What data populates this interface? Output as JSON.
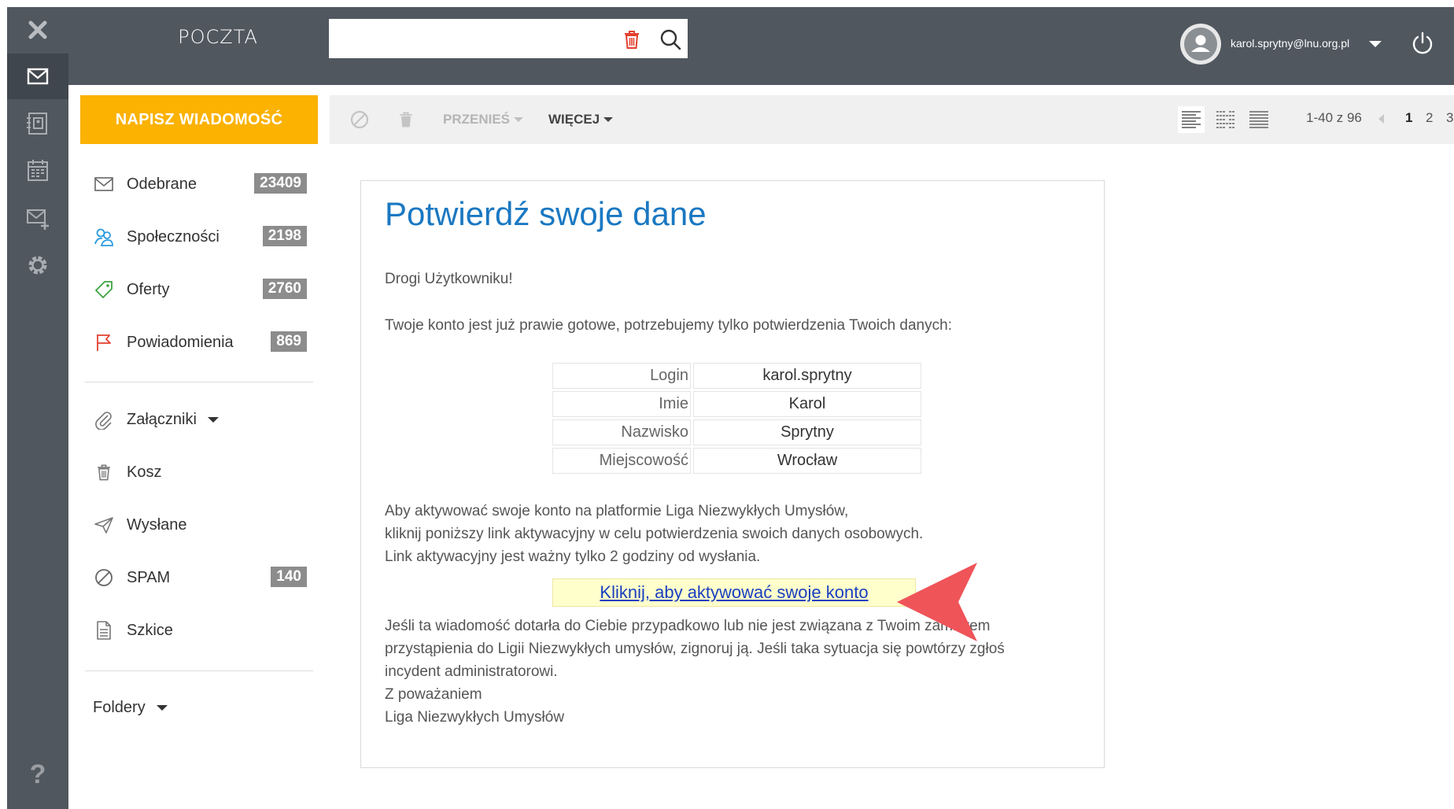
{
  "app": {
    "title": "POCZTA"
  },
  "header": {
    "search": {
      "value": "",
      "placeholder": ""
    },
    "user_email": "karol.sprytny@lnu.org.pl"
  },
  "rail": {
    "items": [
      {
        "name": "close",
        "icon": "close-icon"
      },
      {
        "name": "mail",
        "icon": "envelope-icon",
        "active": true
      },
      {
        "name": "contacts",
        "icon": "address-book-icon"
      },
      {
        "name": "calendar",
        "icon": "calendar-icon"
      },
      {
        "name": "new-mail",
        "icon": "envelope-plus-icon"
      },
      {
        "name": "settings",
        "icon": "gear-icon"
      }
    ],
    "help_label": "?"
  },
  "compose": {
    "label": "NAPISZ WIADOMOŚĆ"
  },
  "toolbar": {
    "move_label": "PRZENIEŚ",
    "more_label": "WIĘCEJ",
    "paging": "1-40 z 96",
    "pages": [
      "1",
      "2",
      "3"
    ],
    "current_page": "1"
  },
  "sidebar": {
    "folders": [
      {
        "label": "Odebrane",
        "count": "23409",
        "icon": "envelope-icon"
      },
      {
        "label": "Społeczności",
        "count": "2198",
        "icon": "people-icon"
      },
      {
        "label": "Oferty",
        "count": "2760",
        "icon": "tag-icon"
      },
      {
        "label": "Powiadomienia",
        "count": "869",
        "icon": "flag-icon"
      },
      {
        "label": "Załączniki",
        "count": "",
        "icon": "paperclip-icon"
      },
      {
        "label": "Kosz",
        "count": "",
        "icon": "trash-icon"
      },
      {
        "label": "Wysłane",
        "count": "",
        "icon": "send-icon"
      },
      {
        "label": "SPAM",
        "count": "140",
        "icon": "ban-icon"
      },
      {
        "label": "Szkice",
        "count": "",
        "icon": "document-icon"
      }
    ],
    "custom_folders_label": "Foldery"
  },
  "message": {
    "title": "Potwierdź swoje dane",
    "greeting": "Drogi Użytkowniku!",
    "intro": "Twoje konto jest już prawie gotowe, potrzebujemy tylko potwierdzenia Twoich danych:",
    "fields": [
      {
        "key": "Login",
        "value": "karol.sprytny"
      },
      {
        "key": "Imie",
        "value": "Karol"
      },
      {
        "key": "Nazwisko",
        "value": "Sprytny"
      },
      {
        "key": "Miejscowość",
        "value": "Wrocław"
      }
    ],
    "body_lines": [
      "Aby aktywować swoje konto na platformie Liga Niezwykłych Umysłów,",
      "kliknij poniższy link aktywacyjny w celu potwierdzenia swoich danych osobowych.",
      "Link aktywacyjny jest ważny tylko 2 godziny od wysłania."
    ],
    "activation_link": "Kliknij, aby aktywować swoje konto",
    "footer_lines": [
      "Jeśli ta wiadomość dotarła do Ciebie przypadkowo lub nie jest związana z Twoim zamiarem",
      "przystąpienia do Ligii Niezwykłych umysłów, zignoruj ją. Jeśli taka sytuacja się powtórzy zgłoś",
      "incydent administratorowi."
    ],
    "signoff": "Z poważaniem",
    "signature": "Liga Niezwykłych Umysłów"
  },
  "colors": {
    "header_bg": "#50575f",
    "compose_bg": "#fbb200",
    "title_blue": "#1a78c2",
    "link_blue": "#1a3fbf",
    "link_highlight": "#ffffcc",
    "annotation_arrow": "#ef5459"
  }
}
